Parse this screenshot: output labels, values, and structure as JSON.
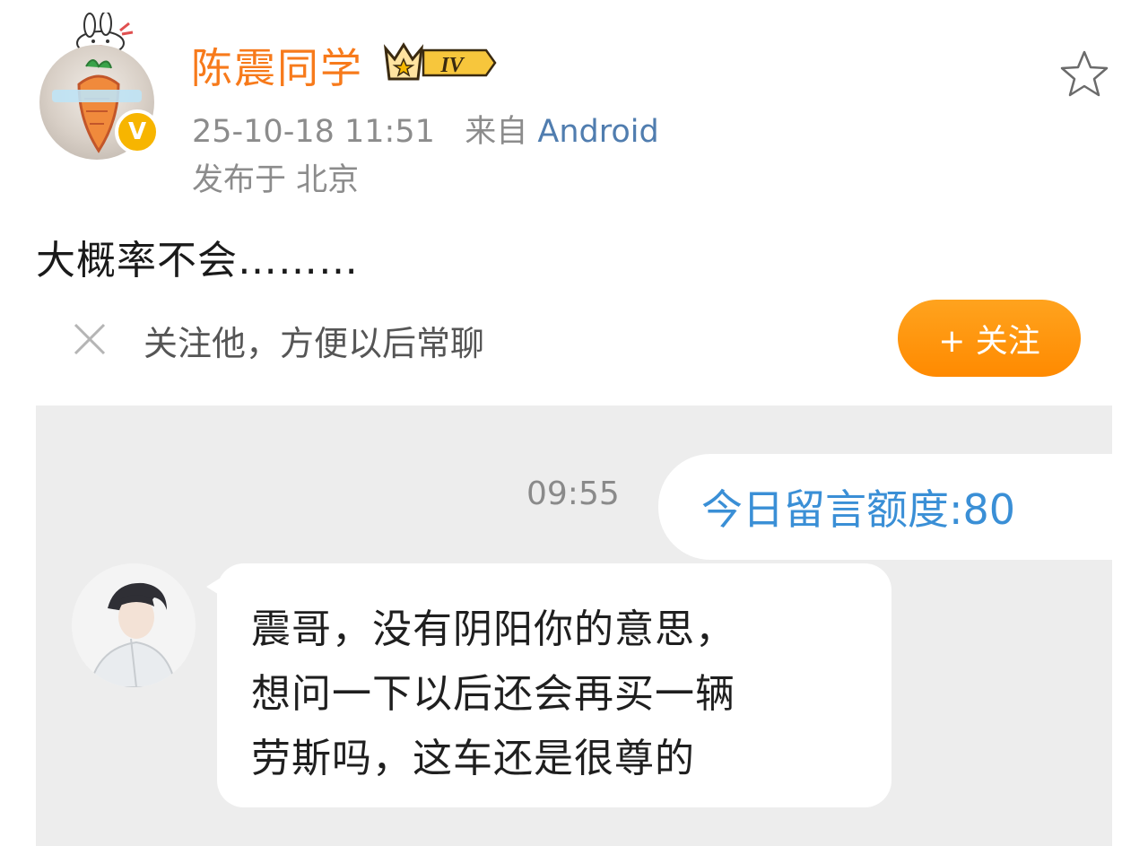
{
  "post": {
    "username": "陈震同学",
    "vip_level": "IV",
    "verified_mark": "V",
    "avatar_icon": "carrot-avatar",
    "timestamp": "25-10-18 11:51",
    "source_prefix": "来自",
    "source_name": "Android",
    "location": "发布于 北京",
    "text": "大概率不会………"
  },
  "follow_bar": {
    "tip": "关注他，方便以后常聊",
    "button_label": "+ 关注"
  },
  "chat": {
    "time": "09:55",
    "quota_message": "今日留言额度:80",
    "message_lines": [
      "震哥，没有阴阳你的意思，",
      "想问一下以后还会再买一辆",
      "劳斯吗，这车还是很尊的"
    ]
  },
  "colors": {
    "username": "#f77a1b",
    "source_link": "#507daf",
    "follow_button": "#ff8a00",
    "quota_text": "#3a8fd6",
    "verified_badge": "#f7b500"
  }
}
